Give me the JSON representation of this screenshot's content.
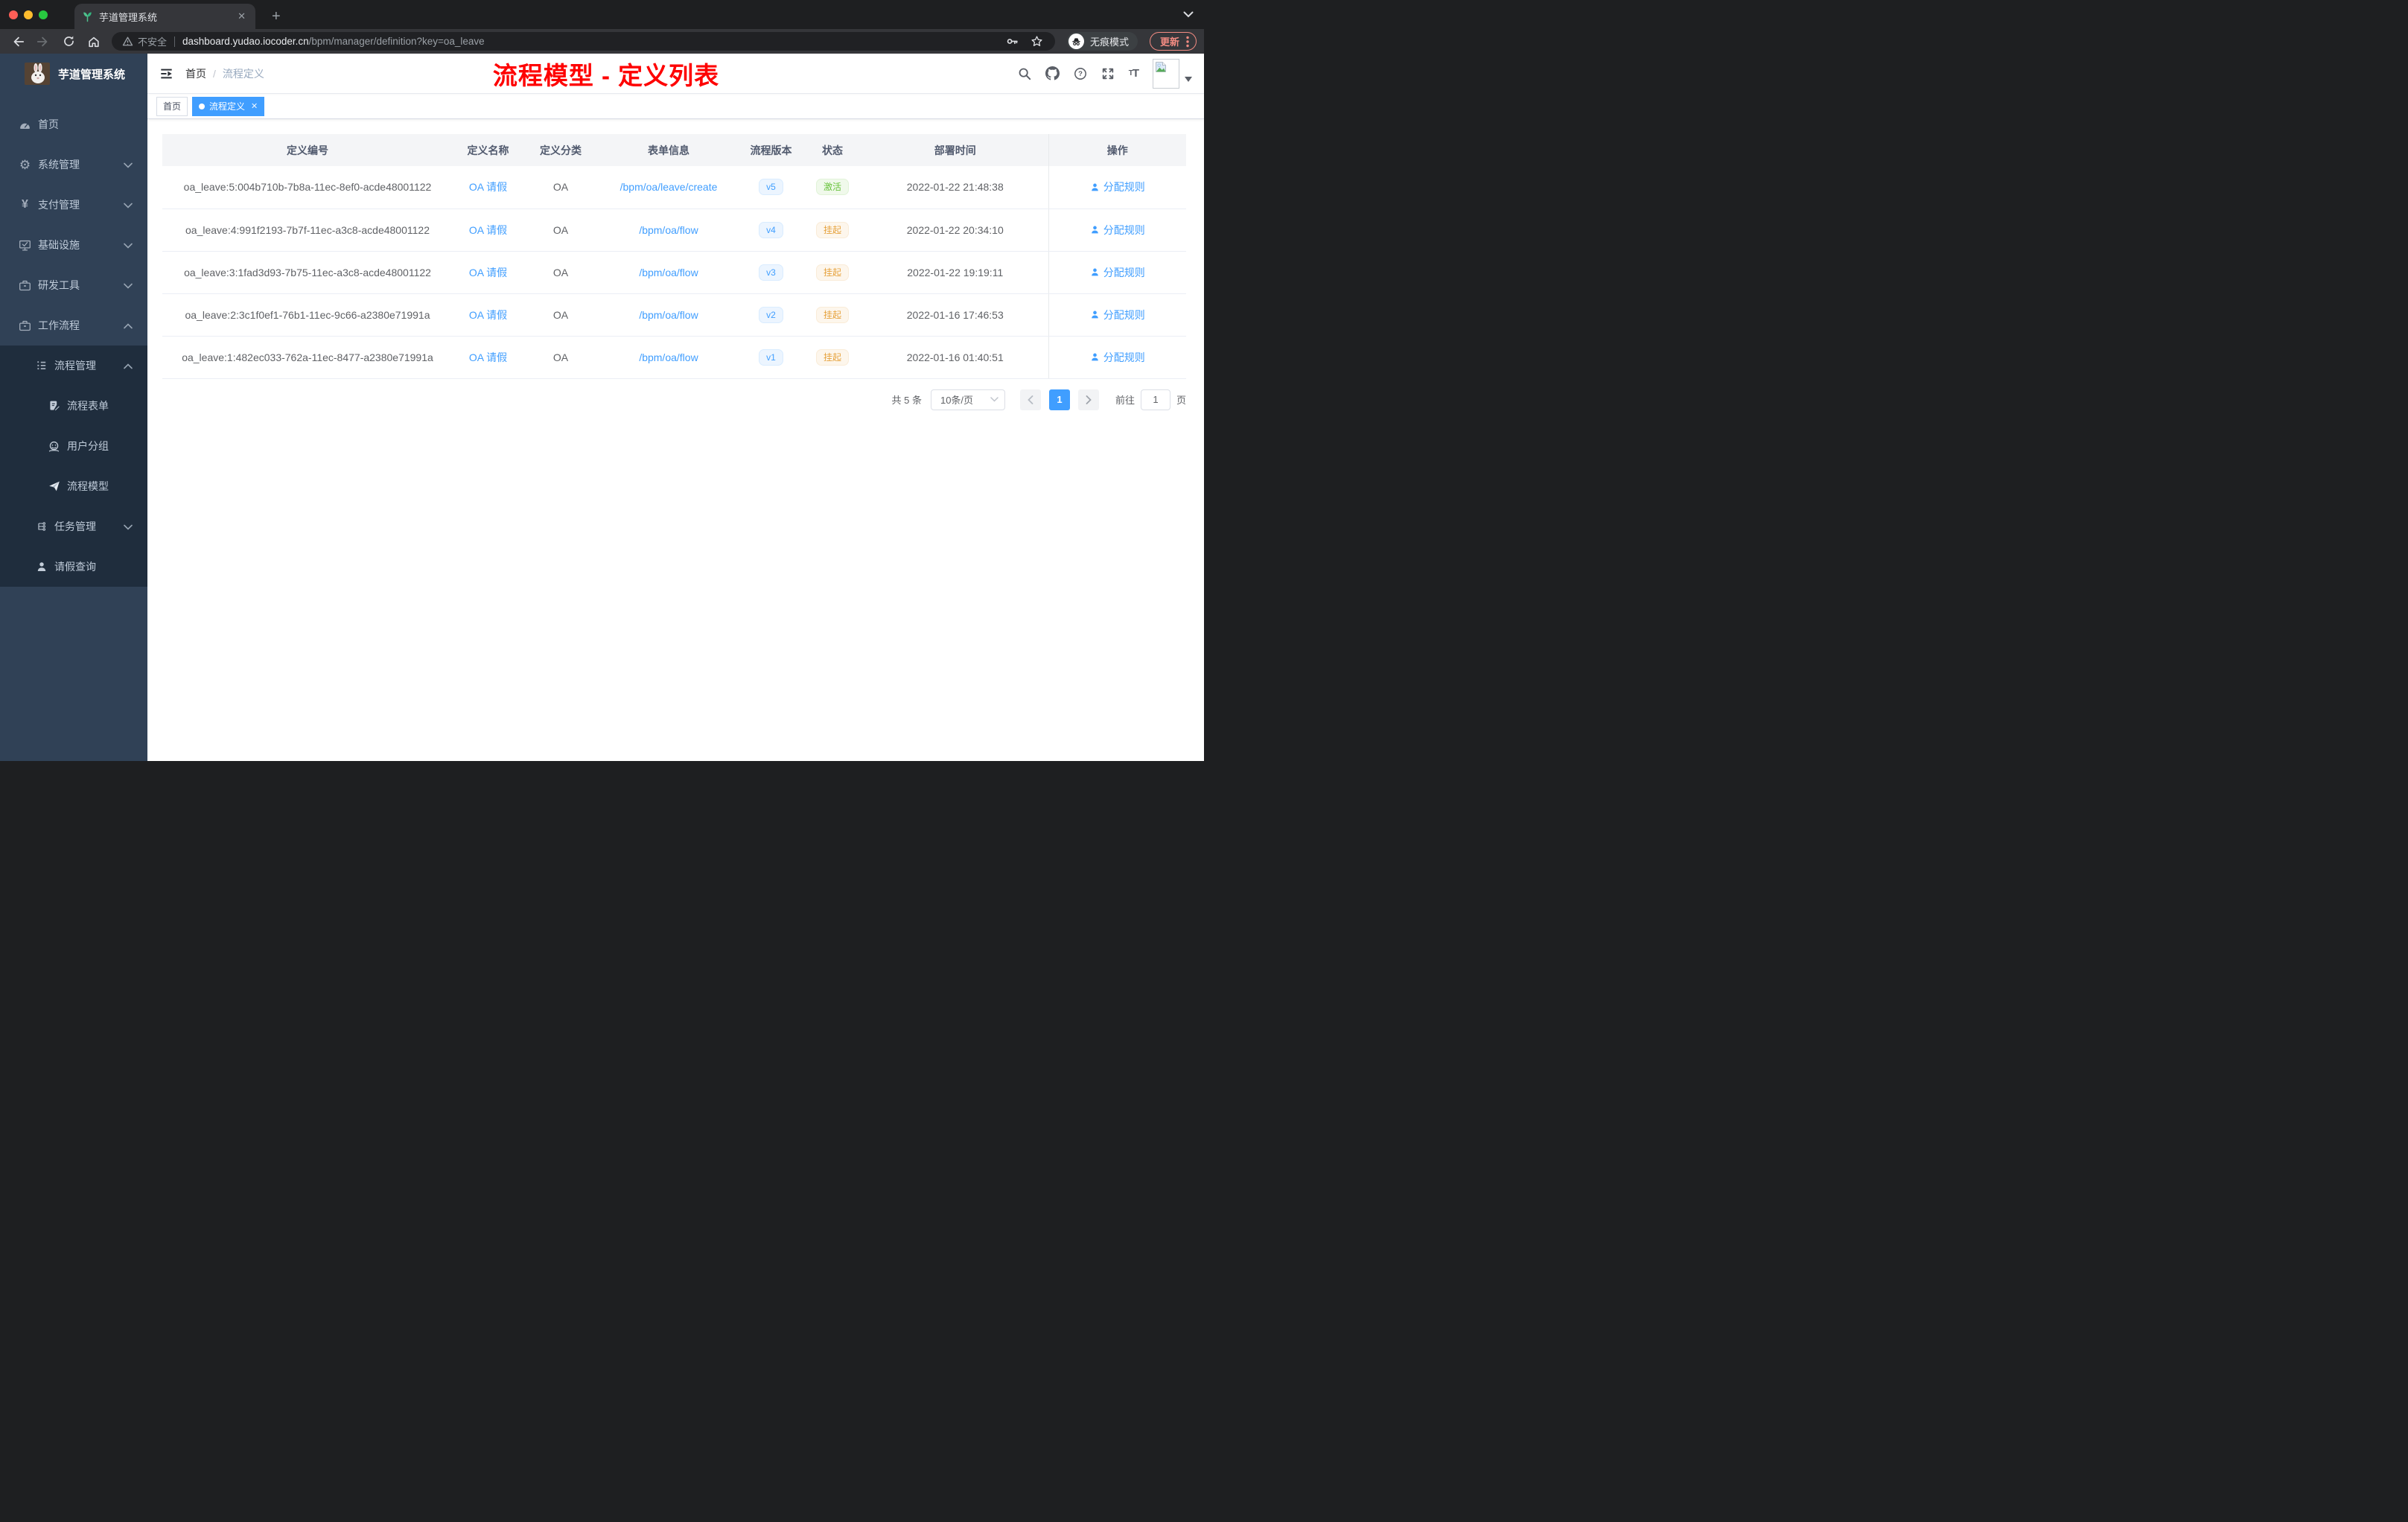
{
  "browser": {
    "tab": {
      "title": "芋道管理系统",
      "close_label": "✕",
      "new_tab_label": "+"
    },
    "address": {
      "security_label": "不安全",
      "url_host": "dashboard.yudao.iocoder.cn",
      "url_path": "/bpm/manager/definition?key=oa_leave",
      "incognito_label": "无痕模式",
      "update_label": "更新"
    }
  },
  "sidebar": {
    "logo_title": "芋道管理系统",
    "items": [
      {
        "label": "首页",
        "icon": "dashboard-icon"
      },
      {
        "label": "系统管理",
        "icon": "gear-icon"
      },
      {
        "label": "支付管理",
        "icon": "yen-icon"
      },
      {
        "label": "基础设施",
        "icon": "monitor-icon"
      },
      {
        "label": "研发工具",
        "icon": "briefcase-icon"
      },
      {
        "label": "工作流程",
        "icon": "briefcase-icon"
      },
      {
        "label": "流程管理",
        "icon": "list-icon"
      },
      {
        "label": "流程表单",
        "icon": "form-icon"
      },
      {
        "label": "用户分组",
        "icon": "people-icon"
      },
      {
        "label": "流程模型",
        "icon": "paper-plane-icon"
      },
      {
        "label": "任务管理",
        "icon": "tree-icon"
      },
      {
        "label": "请假查询",
        "icon": "person-icon"
      }
    ]
  },
  "header": {
    "breadcrumb_home": "首页",
    "breadcrumb_current": "流程定义",
    "annotation": "流程模型 - 定义列表"
  },
  "tags": {
    "home": "首页",
    "active": "流程定义",
    "close": "✕"
  },
  "table": {
    "columns": [
      "定义编号",
      "定义名称",
      "定义分类",
      "表单信息",
      "流程版本",
      "状态",
      "部署时间",
      "操作"
    ],
    "rows": [
      {
        "id": "oa_leave:5:004b710b-7b8a-11ec-8ef0-acde48001122",
        "name": "OA 请假",
        "category": "OA",
        "form": "/bpm/oa/leave/create",
        "version": "v5",
        "status": "激活",
        "time": "2022-01-22 21:48:38",
        "action": "分配规则"
      },
      {
        "id": "oa_leave:4:991f2193-7b7f-11ec-a3c8-acde48001122",
        "name": "OA 请假",
        "category": "OA",
        "form": "/bpm/oa/flow",
        "version": "v4",
        "status": "挂起",
        "time": "2022-01-22 20:34:10",
        "action": "分配规则"
      },
      {
        "id": "oa_leave:3:1fad3d93-7b75-11ec-a3c8-acde48001122",
        "name": "OA 请假",
        "category": "OA",
        "form": "/bpm/oa/flow",
        "version": "v3",
        "status": "挂起",
        "time": "2022-01-22 19:19:11",
        "action": "分配规则"
      },
      {
        "id": "oa_leave:2:3c1f0ef1-76b1-11ec-9c66-a2380e71991a",
        "name": "OA 请假",
        "category": "OA",
        "form": "/bpm/oa/flow",
        "version": "v2",
        "status": "挂起",
        "time": "2022-01-16 17:46:53",
        "action": "分配规则"
      },
      {
        "id": "oa_leave:1:482ec033-762a-11ec-8477-a2380e71991a",
        "name": "OA 请假",
        "category": "OA",
        "form": "/bpm/oa/flow",
        "version": "v1",
        "status": "挂起",
        "time": "2022-01-16 01:40:51",
        "action": "分配规则"
      }
    ]
  },
  "pagination": {
    "total": "共 5 条",
    "page_size": "10条/页",
    "current_page": "1",
    "goto_label": "前往",
    "goto_value": "1",
    "page_suffix": "页"
  },
  "colors": {
    "accent": "#409eff",
    "status_active": "#67c23a",
    "status_suspended": "#e6a23c",
    "annotation_red": "#fe0000",
    "sidebar_bg": "#304156",
    "submenu_bg": "#1f2d3d",
    "favicon_green": "#4fc08d"
  }
}
